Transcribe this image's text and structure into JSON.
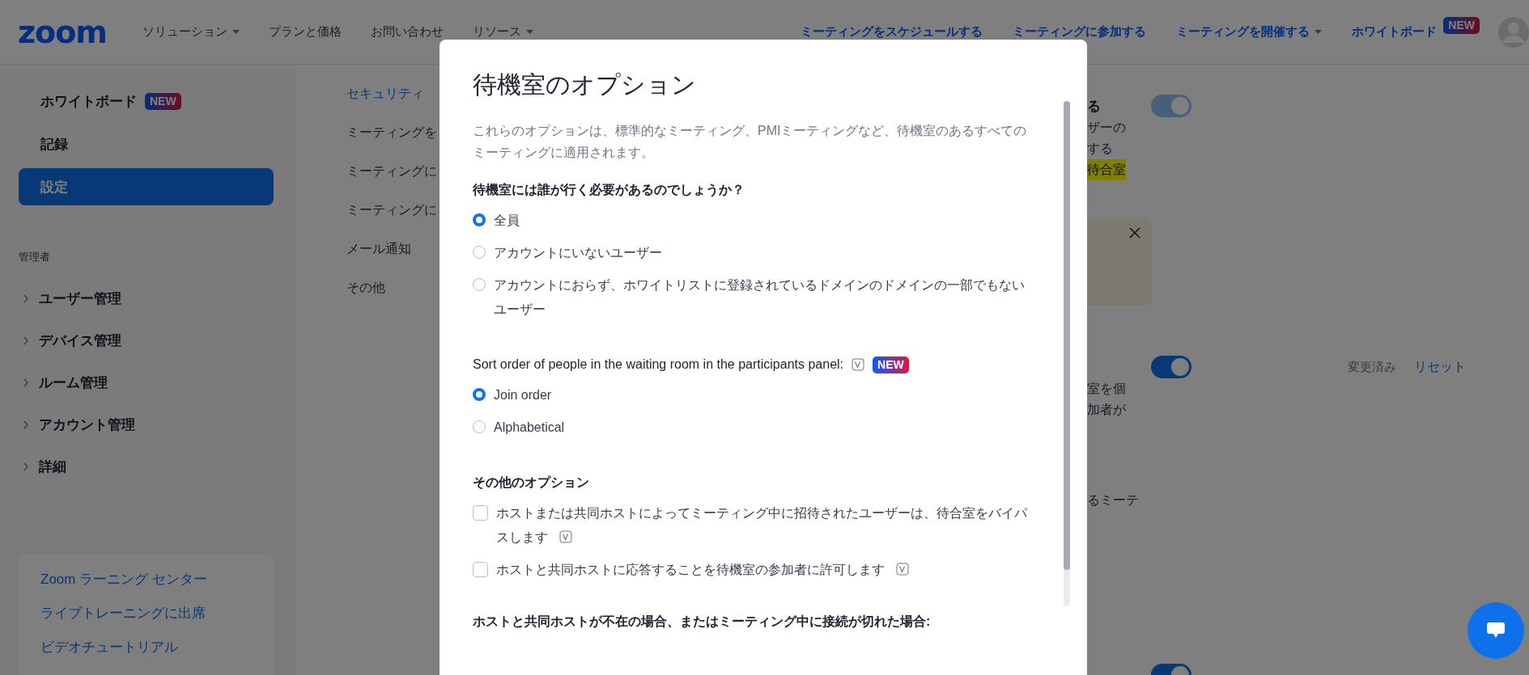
{
  "nav": {
    "logo": "zoom",
    "menu": [
      {
        "label": "ソリューション",
        "dropdown": true
      },
      {
        "label": "プランと価格",
        "dropdown": false
      },
      {
        "label": "お問い合わせ",
        "dropdown": false
      },
      {
        "label": "リソース",
        "dropdown": true
      }
    ],
    "actions": [
      {
        "label": "ミーティングをスケジュールする",
        "dropdown": false
      },
      {
        "label": "ミーティングに参加する",
        "dropdown": false
      },
      {
        "label": "ミーティングを開催する",
        "dropdown": true
      },
      {
        "label": "ホワイトボード",
        "dropdown": false,
        "badge": "NEW"
      }
    ]
  },
  "sidebar": {
    "items": [
      {
        "label": "ホワイトボード",
        "badge": "NEW",
        "selected": false
      },
      {
        "label": "記録",
        "selected": false
      },
      {
        "label": "設定",
        "selected": true
      }
    ],
    "section": "管理者",
    "groups": [
      {
        "label": "ユーザー管理",
        "expanded": false
      },
      {
        "label": "デバイス管理",
        "expanded": false
      },
      {
        "label": "ルーム管理",
        "expanded": false
      },
      {
        "label": "アカウント管理",
        "expanded": false
      },
      {
        "label": "詳細",
        "expanded": false
      }
    ],
    "links": [
      "Zoom ラーニング センター",
      "ライブトレーニングに出席",
      "ビデオチュートリアル"
    ]
  },
  "settings_nav": {
    "items": [
      {
        "label": "セキュリティ",
        "selected": true
      },
      {
        "label": "ミーティングを",
        "selected": false
      },
      {
        "label": "ミーティングに",
        "selected": false
      },
      {
        "label": "ミーティングに",
        "selected": false
      },
      {
        "label": "メール通知",
        "selected": false
      },
      {
        "label": "その他",
        "selected": false
      }
    ]
  },
  "settings": {
    "sections": [
      {
        "kind": "toggle",
        "title": "る",
        "toggle": {
          "on": true,
          "disabled": true
        },
        "lines": [
          "ザーの",
          "する"
        ],
        "highlight": "待合室"
      },
      {
        "kind": "notice",
        "closable": true
      },
      {
        "kind": "toggle",
        "toggle": {
          "on": true,
          "disabled": false
        },
        "status": "変更済み",
        "reset": "リセット",
        "lines": [
          "室を個",
          "加者が"
        ]
      },
      {
        "kind": "text",
        "lines": [
          "るミーテ"
        ]
      },
      {
        "kind": "toggle",
        "toggle": {
          "on": true,
          "disabled": false
        }
      }
    ]
  },
  "modal": {
    "title": "待機室のオプション",
    "description": "これらのオプションは、標準的なミーティング、PMIミーティングなど、待機室のあるすべてのミーティングに適用されます。",
    "groups": [
      {
        "kind": "radio",
        "heading": "待機室には誰が行く必要があるのでしょうか？",
        "bold": true,
        "options": [
          {
            "label": "全員",
            "selected": true
          },
          {
            "label": "アカウントにいないユーザー",
            "selected": false
          },
          {
            "label": "アカウントにおらず、ホワイトリストに登録されているドメインのドメインの一部でもないユーザー",
            "selected": false
          }
        ]
      },
      {
        "kind": "radio",
        "heading": "Sort order of people in the waiting room in the participants panel:",
        "bold": false,
        "info": true,
        "badge": "NEW",
        "options": [
          {
            "label": "Join order",
            "selected": true
          },
          {
            "label": "Alphabetical",
            "selected": false
          }
        ]
      },
      {
        "kind": "checkbox",
        "heading": "その他のオプション",
        "bold": true,
        "options": [
          {
            "label": "ホストまたは共同ホストによってミーティング中に招待されたユーザーは、待合室をバイパスします",
            "checked": false,
            "info": true
          },
          {
            "label": "ホストと共同ホストに応答することを待機室の参加者に許可します",
            "checked": false,
            "info": true
          }
        ]
      },
      {
        "kind": "heading",
        "heading": "ホストと共同ホストが不在の場合、またはミーティング中に接続が切れた場合:",
        "bold": true
      }
    ]
  }
}
